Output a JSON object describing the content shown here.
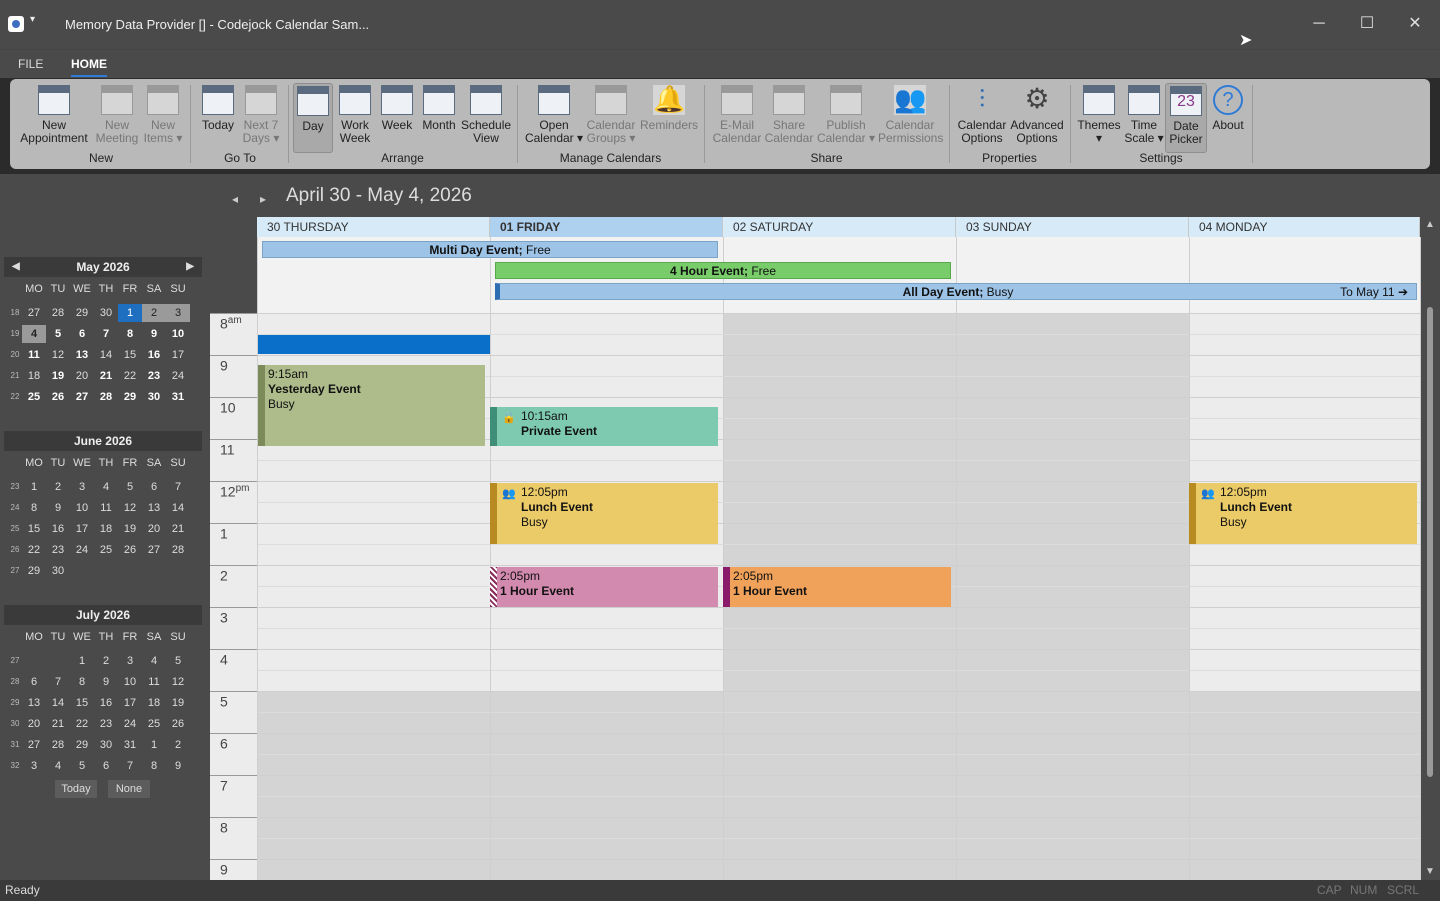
{
  "window": {
    "title": "Memory Data Provider [] - Codejock Calendar Sam...",
    "min": "─",
    "max": "☐",
    "close": "✕",
    "menu": "▾"
  },
  "tabs": [
    {
      "label": "FILE"
    },
    {
      "label": "HOME"
    }
  ],
  "ribbon": {
    "buttons": [
      {
        "l1": "New",
        "l2": "Appointment"
      },
      {
        "l1": "New",
        "l2": "Meeting"
      },
      {
        "l1": "New",
        "l2": "Items ▾"
      },
      {
        "l1": "Today",
        "l2": ""
      },
      {
        "l1": "Next 7",
        "l2": "Days ▾"
      },
      {
        "l1": "Day",
        "l2": ""
      },
      {
        "l1": "Work",
        "l2": "Week"
      },
      {
        "l1": "Week",
        "l2": ""
      },
      {
        "l1": "Month",
        "l2": ""
      },
      {
        "l1": "Schedule",
        "l2": "View"
      },
      {
        "l1": "Open",
        "l2": "Calendar ▾"
      },
      {
        "l1": "Calendar",
        "l2": "Groups ▾"
      },
      {
        "l1": "Reminders",
        "l2": ""
      },
      {
        "l1": "E-Mail",
        "l2": "Calendar"
      },
      {
        "l1": "Share",
        "l2": "Calendar"
      },
      {
        "l1": "Publish",
        "l2": "Calendar ▾"
      },
      {
        "l1": "Calendar",
        "l2": "Permissions"
      },
      {
        "l1": "Calendar",
        "l2": "Options"
      },
      {
        "l1": "Advanced",
        "l2": "Options"
      },
      {
        "l1": "Themes",
        "l2": "▾"
      },
      {
        "l1": "Time",
        "l2": "Scale ▾"
      },
      {
        "l1": "Date",
        "l2": "Picker"
      },
      {
        "l1": "About",
        "l2": ""
      }
    ],
    "groups": [
      "New",
      "Go To",
      "Arrange",
      "Manage Calendars",
      "Share",
      "Properties",
      "Settings"
    ],
    "date_picker_day": "23",
    "about_glyph": "?",
    "gear_glyph": "⚙"
  },
  "minicals": [
    {
      "title": "May 2026",
      "dow": [
        "MO",
        "TU",
        "WE",
        "TH",
        "FR",
        "SA",
        "SU"
      ],
      "weeks": [
        {
          "wk": "18",
          "days": [
            "27",
            "28",
            "29",
            "30",
            "1",
            "2",
            "3"
          ]
        },
        {
          "wk": "19",
          "days": [
            "4",
            "5",
            "6",
            "7",
            "8",
            "9",
            "10"
          ]
        },
        {
          "wk": "20",
          "days": [
            "11",
            "12",
            "13",
            "14",
            "15",
            "16",
            "17"
          ]
        },
        {
          "wk": "21",
          "days": [
            "18",
            "19",
            "20",
            "21",
            "22",
            "23",
            "24"
          ]
        },
        {
          "wk": "22",
          "days": [
            "25",
            "26",
            "27",
            "28",
            "29",
            "30",
            "31"
          ]
        }
      ]
    },
    {
      "title": "June 2026",
      "dow": [
        "MO",
        "TU",
        "WE",
        "TH",
        "FR",
        "SA",
        "SU"
      ],
      "weeks": [
        {
          "wk": "23",
          "days": [
            "1",
            "2",
            "3",
            "4",
            "5",
            "6",
            "7"
          ]
        },
        {
          "wk": "24",
          "days": [
            "8",
            "9",
            "10",
            "11",
            "12",
            "13",
            "14"
          ]
        },
        {
          "wk": "25",
          "days": [
            "15",
            "16",
            "17",
            "18",
            "19",
            "20",
            "21"
          ]
        },
        {
          "wk": "26",
          "days": [
            "22",
            "23",
            "24",
            "25",
            "26",
            "27",
            "28"
          ]
        },
        {
          "wk": "27",
          "days": [
            "29",
            "30",
            "",
            "",
            "",
            "",
            ""
          ]
        }
      ]
    },
    {
      "title": "July 2026",
      "dow": [
        "MO",
        "TU",
        "WE",
        "TH",
        "FR",
        "SA",
        "SU"
      ],
      "weeks": [
        {
          "wk": "27",
          "days": [
            "",
            "",
            "1",
            "2",
            "3",
            "4",
            "5"
          ]
        },
        {
          "wk": "28",
          "days": [
            "6",
            "7",
            "8",
            "9",
            "10",
            "11",
            "12"
          ]
        },
        {
          "wk": "29",
          "days": [
            "13",
            "14",
            "15",
            "16",
            "17",
            "18",
            "19"
          ]
        },
        {
          "wk": "30",
          "days": [
            "20",
            "21",
            "22",
            "23",
            "24",
            "25",
            "26"
          ]
        },
        {
          "wk": "31",
          "days": [
            "27",
            "28",
            "29",
            "30",
            "31",
            "1",
            "2"
          ]
        },
        {
          "wk": "32",
          "days": [
            "3",
            "4",
            "5",
            "6",
            "7",
            "8",
            "9"
          ]
        }
      ]
    }
  ],
  "minical_buttons": {
    "today": "Today",
    "none": "None"
  },
  "calendar": {
    "range": "April 30 - May 4, 2026",
    "prev": "◂",
    "next": "▸",
    "days": [
      "30 THURSDAY",
      "01 FRIDAY",
      "02 SATURDAY",
      "03 SUNDAY",
      "04 MONDAY"
    ],
    "hours": [
      {
        "h": "8",
        "ap": "am"
      },
      {
        "h": "9",
        "ap": ""
      },
      {
        "h": "10",
        "ap": ""
      },
      {
        "h": "11",
        "ap": ""
      },
      {
        "h": "12",
        "ap": "pm"
      },
      {
        "h": "1",
        "ap": ""
      },
      {
        "h": "2",
        "ap": ""
      },
      {
        "h": "3",
        "ap": ""
      },
      {
        "h": "4",
        "ap": ""
      },
      {
        "h": "5",
        "ap": ""
      },
      {
        "h": "6",
        "ap": ""
      },
      {
        "h": "7",
        "ap": ""
      },
      {
        "h": "8",
        "ap": ""
      },
      {
        "h": "9",
        "ap": ""
      }
    ],
    "allday": [
      {
        "title": "Multi Day Event;",
        "status": " Free"
      },
      {
        "title": "4 Hour Event;",
        "status": " Free"
      },
      {
        "title": "All Day Event;",
        "status": " Busy",
        "more": "To May 11 ➔"
      }
    ],
    "events": [
      {
        "time": "9:15am",
        "title": "Yesterday Event",
        "status": "Busy"
      },
      {
        "time": "10:15am",
        "title": "Private Event",
        "status": ""
      },
      {
        "time": "12:05pm",
        "title": "Lunch Event",
        "status": "Busy"
      },
      {
        "time": "2:05pm",
        "title": "1 Hour Event",
        "status": ""
      },
      {
        "time": "2:05pm",
        "title": "1 Hour Event",
        "status": ""
      },
      {
        "time": "12:05pm",
        "title": "Lunch Event",
        "status": "Busy"
      }
    ],
    "colors": {
      "blue": "#0a6fc9",
      "olive": "#aebb8b",
      "teal": "#7dcab0",
      "yellow": "#ebca68",
      "pink": "#d28aae",
      "orange": "#f0a15a",
      "green": "#79cc6a",
      "lightblue": "#9dc3e6"
    }
  },
  "status": {
    "ready": "Ready",
    "cap": "CAP",
    "num": "NUM",
    "scrl": "SCRL"
  }
}
